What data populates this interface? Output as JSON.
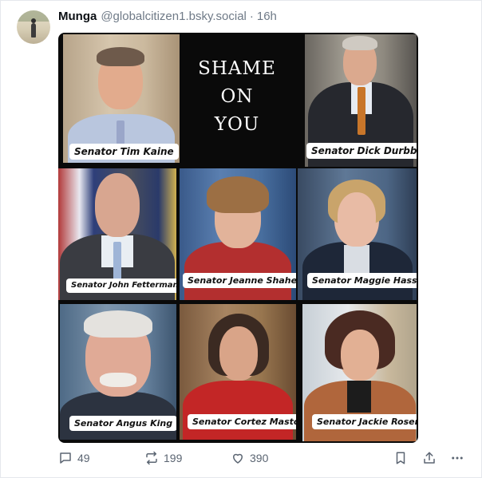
{
  "post": {
    "author_name": "Munga",
    "handle": "@globalcitizen1.bsky.social",
    "separator": "·",
    "time": "16h"
  },
  "graphic": {
    "shame_lines": [
      "SHAME",
      "ON",
      "YOU"
    ],
    "labels": [
      "Senator Tim Kaine",
      "Senator Dick Durbbin",
      "Senator John Fetterman",
      "Senator Jeanne Shaheen",
      "Senator Maggie Hassan",
      "Senator Angus King",
      "Senator Cortez Masto",
      "Senator Jackie Rosen"
    ]
  },
  "actions": {
    "replies": "49",
    "reposts": "199",
    "likes": "390"
  },
  "icons": [
    "reply-icon",
    "repost-icon",
    "like-icon",
    "bookmark-icon",
    "share-icon",
    "more-icon"
  ]
}
